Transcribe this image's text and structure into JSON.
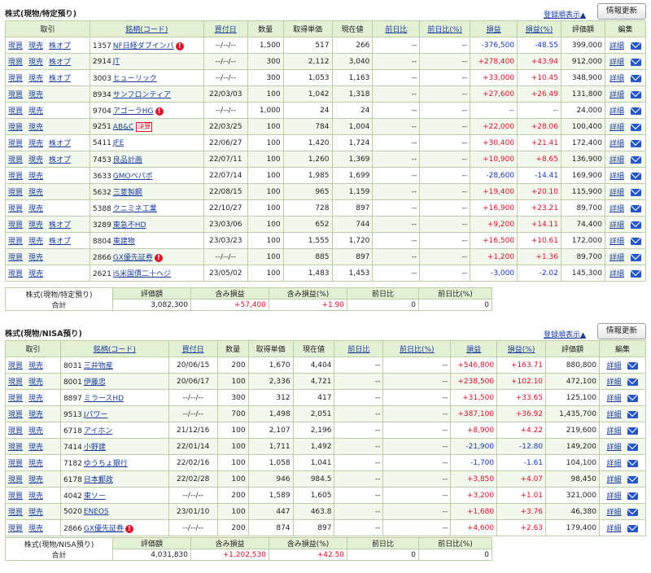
{
  "sections": [
    {
      "title": "株式(現物/特定預り)",
      "sort_label": "登録順表示▲",
      "refresh_label": "情報更新",
      "columns": [
        "取引",
        "銘柄(コード)",
        "買付日",
        "数量",
        "取得単価",
        "現在値",
        "前日比",
        "前日比(%)",
        "損益",
        "損益(%)",
        "評価額",
        "編集"
      ],
      "trade_labels": {
        "buy": "現買",
        "sell": "現売",
        "option": "株オプ"
      },
      "edit_label": "詳細",
      "rows": [
        {
          "opt": true,
          "code": "1357",
          "name": "NF日経ダブインバ",
          "badge": "info",
          "date": "--/--/--",
          "qty": "1,500",
          "cost": "517",
          "price": "266",
          "chg": "--",
          "chg_pct": "--",
          "pl": "-376,500",
          "pl_pct": "-48.55",
          "value": "399,000"
        },
        {
          "opt": true,
          "code": "2914",
          "name": "JT",
          "badge": "",
          "date": "--/--/--",
          "qty": "300",
          "cost": "2,112",
          "price": "3,040",
          "chg": "--",
          "chg_pct": "--",
          "pl": "+278,400",
          "pl_pct": "+43.94",
          "value": "912,000"
        },
        {
          "opt": true,
          "code": "3003",
          "name": "ヒューリック",
          "badge": "",
          "date": "--/--/--",
          "qty": "300",
          "cost": "1,053",
          "price": "1,163",
          "chg": "--",
          "chg_pct": "--",
          "pl": "+33,000",
          "pl_pct": "+10.45",
          "value": "348,900"
        },
        {
          "opt": false,
          "code": "8934",
          "name": "サンフロンティア",
          "badge": "",
          "date": "22/03/03",
          "qty": "100",
          "cost": "1,042",
          "price": "1,318",
          "chg": "--",
          "chg_pct": "--",
          "pl": "+27,600",
          "pl_pct": "+26.49",
          "value": "131,800"
        },
        {
          "opt": false,
          "code": "9704",
          "name": "アゴーラHG",
          "badge": "info",
          "date": "--/--/--",
          "qty": "1,000",
          "cost": "24",
          "price": "24",
          "chg": "--",
          "chg_pct": "--",
          "pl": "--",
          "pl_pct": "--",
          "value": "24,000"
        },
        {
          "opt": false,
          "code": "9251",
          "name": "AB&C",
          "badge": "kessan",
          "date": "22/03/25",
          "qty": "100",
          "cost": "784",
          "price": "1,004",
          "chg": "--",
          "chg_pct": "--",
          "pl": "+22,000",
          "pl_pct": "+28.06",
          "value": "100,400"
        },
        {
          "opt": true,
          "code": "5411",
          "name": "JFE",
          "badge": "",
          "date": "22/06/27",
          "qty": "100",
          "cost": "1,420",
          "price": "1,724",
          "chg": "--",
          "chg_pct": "--",
          "pl": "+30,400",
          "pl_pct": "+21.41",
          "value": "172,400"
        },
        {
          "opt": true,
          "code": "7453",
          "name": "良品計画",
          "badge": "",
          "date": "22/07/11",
          "qty": "100",
          "cost": "1,260",
          "price": "1,369",
          "chg": "--",
          "chg_pct": "--",
          "pl": "+10,900",
          "pl_pct": "+8.65",
          "value": "136,900"
        },
        {
          "opt": false,
          "code": "3633",
          "name": "GMOペパボ",
          "badge": "",
          "date": "22/07/14",
          "qty": "100",
          "cost": "1,985",
          "price": "1,699",
          "chg": "--",
          "chg_pct": "--",
          "pl": "-28,600",
          "pl_pct": "-14.41",
          "value": "169,900"
        },
        {
          "opt": false,
          "code": "5632",
          "name": "三菱製鋼",
          "badge": "",
          "date": "22/08/15",
          "qty": "100",
          "cost": "965",
          "price": "1,159",
          "chg": "--",
          "chg_pct": "--",
          "pl": "+19,400",
          "pl_pct": "+20.10",
          "value": "115,900"
        },
        {
          "opt": false,
          "code": "5388",
          "name": "クニミネ工業",
          "badge": "",
          "date": "22/10/27",
          "qty": "100",
          "cost": "728",
          "price": "897",
          "chg": "--",
          "chg_pct": "--",
          "pl": "+16,900",
          "pl_pct": "+23.21",
          "value": "89,700"
        },
        {
          "opt": true,
          "code": "3289",
          "name": "東急不HD",
          "badge": "",
          "date": "23/03/06",
          "qty": "100",
          "cost": "652",
          "price": "744",
          "chg": "--",
          "chg_pct": "--",
          "pl": "+9,200",
          "pl_pct": "+14.11",
          "value": "74,400"
        },
        {
          "opt": true,
          "code": "8804",
          "name": "東建物",
          "badge": "",
          "date": "23/03/23",
          "qty": "100",
          "cost": "1,555",
          "price": "1,720",
          "chg": "--",
          "chg_pct": "--",
          "pl": "+16,500",
          "pl_pct": "+10.61",
          "value": "172,000"
        },
        {
          "opt": false,
          "code": "2866",
          "name": "GX優先証券",
          "badge": "info",
          "date": "--/--/--",
          "qty": "100",
          "cost": "885",
          "price": "897",
          "chg": "--",
          "chg_pct": "--",
          "pl": "+1,200",
          "pl_pct": "+1.36",
          "value": "89,700"
        },
        {
          "opt": false,
          "code": "2621",
          "name": "iS米国債二十ヘジ",
          "badge": "",
          "date": "23/05/02",
          "qty": "100",
          "cost": "1,483",
          "price": "1,453",
          "chg": "--",
          "chg_pct": "--",
          "pl": "-3,000",
          "pl_pct": "-2.02",
          "value": "145,300"
        }
      ],
      "summary": {
        "label_top": "株式(現物/特定預り)",
        "label_bottom": "合計",
        "headers": [
          "評価額",
          "含み損益",
          "含み損益(%)",
          "前日比",
          "前日比(%)"
        ],
        "values": [
          "3,082,300",
          "+57,400",
          "+1.90",
          "0",
          "0"
        ]
      }
    },
    {
      "title": "株式(現物/NISA預り)",
      "sort_label": "登録順表示▲",
      "refresh_label": "情報更新",
      "columns": [
        "取引",
        "銘柄(コード)",
        "買付日",
        "数量",
        "取得単価",
        "現在値",
        "前日比",
        "前日比(%)",
        "損益",
        "損益(%)",
        "評価額",
        "編集"
      ],
      "trade_labels": {
        "buy": "現買",
        "sell": "現売",
        "option": "株オプ"
      },
      "edit_label": "詳細",
      "rows": [
        {
          "opt": false,
          "code": "8031",
          "name": "三井物産",
          "badge": "",
          "date": "20/06/15",
          "qty": "200",
          "cost": "1,670",
          "price": "4,404",
          "chg": "--",
          "chg_pct": "--",
          "pl": "+546,800",
          "pl_pct": "+163.71",
          "value": "880,800"
        },
        {
          "opt": false,
          "code": "8001",
          "name": "伊藤忠",
          "badge": "",
          "date": "20/06/17",
          "qty": "100",
          "cost": "2,336",
          "price": "4,721",
          "chg": "--",
          "chg_pct": "--",
          "pl": "+238,500",
          "pl_pct": "+102.10",
          "value": "472,100"
        },
        {
          "opt": false,
          "code": "8897",
          "name": "ミラースHD",
          "badge": "",
          "date": "--/--/--",
          "qty": "300",
          "cost": "312",
          "price": "417",
          "chg": "--",
          "chg_pct": "--",
          "pl": "+31,500",
          "pl_pct": "+33.65",
          "value": "125,100"
        },
        {
          "opt": false,
          "code": "9513",
          "name": "Jパワー",
          "badge": "",
          "date": "--/--/--",
          "qty": "700",
          "cost": "1,498",
          "price": "2,051",
          "chg": "--",
          "chg_pct": "--",
          "pl": "+387,100",
          "pl_pct": "+36.92",
          "value": "1,435,700"
        },
        {
          "opt": false,
          "code": "6718",
          "name": "アイホン",
          "badge": "",
          "date": "21/12/16",
          "qty": "100",
          "cost": "2,107",
          "price": "2,196",
          "chg": "--",
          "chg_pct": "--",
          "pl": "+8,900",
          "pl_pct": "+4.22",
          "value": "219,600"
        },
        {
          "opt": false,
          "code": "7414",
          "name": "小野建",
          "badge": "",
          "date": "22/01/14",
          "qty": "100",
          "cost": "1,711",
          "price": "1,492",
          "chg": "--",
          "chg_pct": "--",
          "pl": "-21,900",
          "pl_pct": "-12.80",
          "value": "149,200"
        },
        {
          "opt": false,
          "code": "7182",
          "name": "ゆうちょ銀行",
          "badge": "",
          "date": "22/02/16",
          "qty": "100",
          "cost": "1,058",
          "price": "1,041",
          "chg": "--",
          "chg_pct": "--",
          "pl": "-1,700",
          "pl_pct": "-1.61",
          "value": "104,100"
        },
        {
          "opt": false,
          "code": "6178",
          "name": "日本郵政",
          "badge": "",
          "date": "22/02/28",
          "qty": "100",
          "cost": "946",
          "price": "984.5",
          "chg": "--",
          "chg_pct": "--",
          "pl": "+3,850",
          "pl_pct": "+4.07",
          "value": "98,450"
        },
        {
          "opt": false,
          "code": "4042",
          "name": "東ソー",
          "badge": "",
          "date": "--/--/--",
          "qty": "200",
          "cost": "1,589",
          "price": "1,605",
          "chg": "--",
          "chg_pct": "--",
          "pl": "+3,200",
          "pl_pct": "+1.01",
          "value": "321,000"
        },
        {
          "opt": false,
          "code": "5020",
          "name": "ENEOS",
          "badge": "",
          "date": "23/01/10",
          "qty": "100",
          "cost": "447",
          "price": "463.8",
          "chg": "--",
          "chg_pct": "--",
          "pl": "+1,680",
          "pl_pct": "+3.76",
          "value": "46,380"
        },
        {
          "opt": false,
          "code": "2866",
          "name": "GX優先証券",
          "badge": "info",
          "date": "--/--/--",
          "qty": "200",
          "cost": "874",
          "price": "897",
          "chg": "--",
          "chg_pct": "--",
          "pl": "+4,600",
          "pl_pct": "+2.63",
          "value": "179,400"
        }
      ],
      "summary": {
        "label_top": "株式(現物/NISA預り)",
        "label_bottom": "合計",
        "headers": [
          "評価額",
          "含み損益",
          "含み損益(%)",
          "前日比",
          "前日比(%)"
        ],
        "values": [
          "4,031,830",
          "+1,202,530",
          "+42.50",
          "0",
          "0"
        ]
      }
    }
  ],
  "badges": {
    "info": "!",
    "kessan": "決算"
  },
  "colors": {
    "header_bg": "#e3f0d3",
    "border": "#b9cfa4",
    "positive": "#e0102b",
    "negative": "#1533c8",
    "link": "#1a3d9c"
  }
}
